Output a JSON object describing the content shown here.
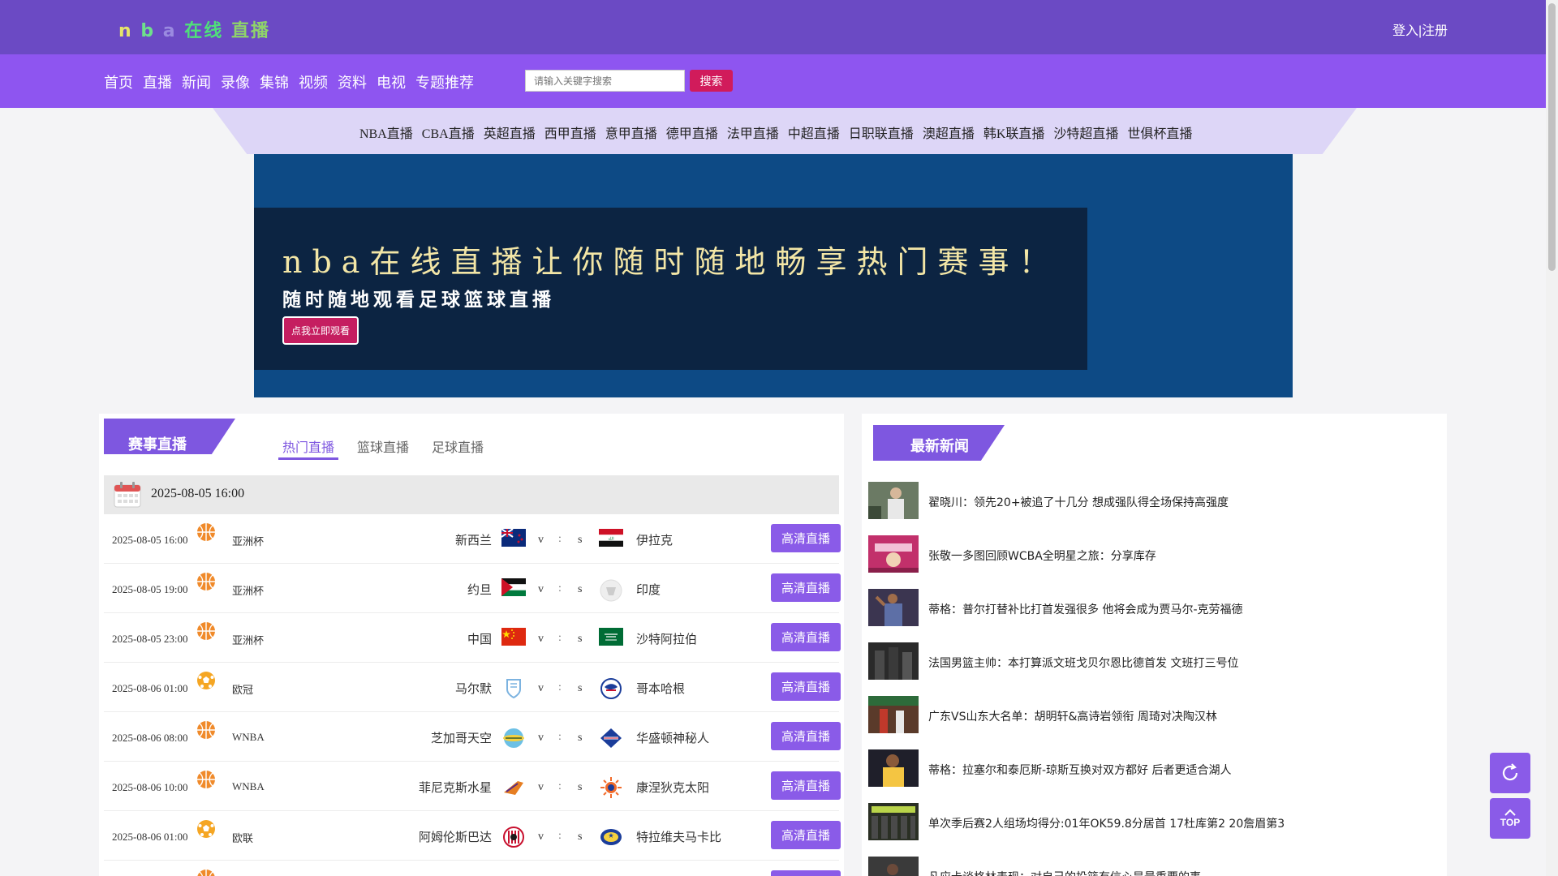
{
  "header": {
    "logo": [
      "n",
      "b",
      "a",
      "在线",
      "直播"
    ],
    "auth_login": "登入",
    "auth_sep": "|",
    "auth_register": "注册"
  },
  "nav": {
    "items": [
      "首页",
      "直播",
      "新闻",
      "录像",
      "集锦",
      "视频",
      "资料",
      "电视",
      "专题推荐"
    ],
    "search_placeholder": "请输入关键字搜索",
    "search_button": "搜索"
  },
  "subnav": [
    "NBA直播",
    "CBA直播",
    "英超直播",
    "西甲直播",
    "意甲直播",
    "德甲直播",
    "法甲直播",
    "中超直播",
    "日职联直播",
    "澳超直播",
    "韩K联直播",
    "沙特超直播",
    "世俱杯直播"
  ],
  "banner": {
    "title": "nba在线直播让你随时随地畅享热门赛事！",
    "subtitle": "随时随地观看足球篮球直播",
    "button": "点我立即观看"
  },
  "matches": {
    "section_title": "赛事直播",
    "tabs": [
      "热门直播",
      "篮球直播",
      "足球直播"
    ],
    "date": "2025-08-05 16:00",
    "live_label": "高清直播",
    "rows": [
      {
        "time": "2025-08-05 16:00",
        "sport": "basketball",
        "league": "亚洲杯",
        "home": "新西兰",
        "away": "伊拉克",
        "v": "v",
        "colon": ":",
        "s": "s"
      },
      {
        "time": "2025-08-05 19:00",
        "sport": "basketball",
        "league": "亚洲杯",
        "home": "约旦",
        "away": "印度",
        "v": "v",
        "colon": ":",
        "s": "s"
      },
      {
        "time": "2025-08-05 23:00",
        "sport": "basketball",
        "league": "亚洲杯",
        "home": "中国",
        "away": "沙特阿拉伯",
        "v": "v",
        "colon": ":",
        "s": "s"
      },
      {
        "time": "2025-08-06 01:00",
        "sport": "football",
        "league": "欧冠",
        "home": "马尔默",
        "away": "哥本哈根",
        "v": "v",
        "colon": ":",
        "s": "s"
      },
      {
        "time": "2025-08-06 08:00",
        "sport": "basketball",
        "league": "WNBA",
        "home": "芝加哥天空",
        "away": "华盛顿神秘人",
        "v": "v",
        "colon": ":",
        "s": "s"
      },
      {
        "time": "2025-08-06 10:00",
        "sport": "basketball",
        "league": "WNBA",
        "home": "菲尼克斯水星",
        "away": "康涅狄克太阳",
        "v": "v",
        "colon": ":",
        "s": "s"
      },
      {
        "time": "2025-08-06 01:00",
        "sport": "football",
        "league": "欧联",
        "home": "阿姆伦斯巴达",
        "away": "特拉维夫马卡比",
        "v": "v",
        "colon": ":",
        "s": "s"
      }
    ]
  },
  "news": {
    "section_title": "最新新闻",
    "items": [
      "翟晓川：领先20+被追了十几分 想成强队得全场保持高强度",
      "张敬一多图回顾WCBA全明星之旅：分享库存",
      "蒂格：普尔打替补比打首发强很多 他将会成为贾马尔-克劳福德",
      "法国男篮主帅：本打算派文班戈贝尔恩比德首发 文班打三号位",
      "广东VS山东大名单：胡明轩&高诗岩领衔 周琦对决陶汉林",
      "蒂格：拉塞尔和泰厄斯-琼斯互换对双方都好 后者更适合湖人",
      "单次季后赛2人组场均得分:01年OK59.8分居首 17杜库第2 20詹眉第3",
      "凡应卡谈格林表现：对自己的投篮有信心是最重要的事"
    ]
  },
  "float": {
    "top_label": "TOP"
  },
  "colors": {
    "topbar": "#6b4ac4",
    "navbar": "#8e55f0",
    "accent": "#8a5be8",
    "search_btn": "#d11b5b",
    "banner_bg": "#0d4a85"
  }
}
